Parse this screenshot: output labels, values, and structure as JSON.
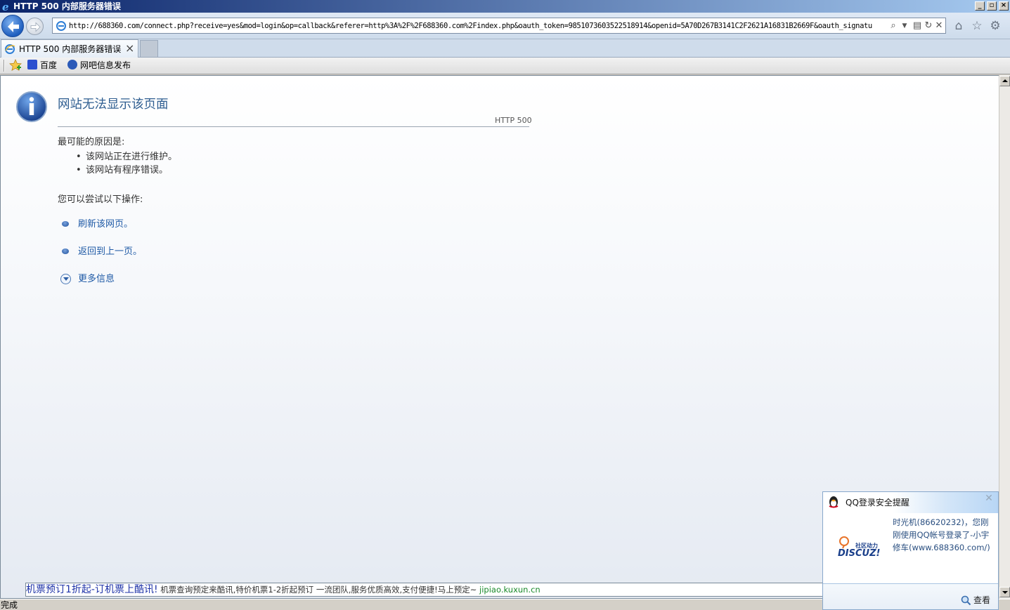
{
  "window": {
    "title": "HTTP 500 内部服务器错误",
    "minimize": "_",
    "restore": "▫",
    "close": "×"
  },
  "address_bar": {
    "url": "http://688360.com/connect.php?receive=yes&mod=login&op=callback&referer=http%3A%2F%2F688360.com%2Findex.php&oauth_token=9851073603522518914&openid=5A70D267B3141C2F2621A16831B2669F&oauth_signatu",
    "icons": [
      "search-icon",
      "dropdown-icon",
      "compat-view-icon",
      "refresh-icon",
      "stop-icon"
    ]
  },
  "toolbar_icons": [
    "home-icon",
    "favorites-star-icon",
    "tools-gear-icon"
  ],
  "tabs": [
    {
      "label": "HTTP  500  内部服务器错误",
      "close": "×"
    }
  ],
  "favorites": [
    {
      "label": "百度"
    },
    {
      "label": "网吧信息发布"
    }
  ],
  "error_page": {
    "title": "网站无法显示该页面",
    "code": "HTTP 500",
    "reasons_heading": "最可能的原因是:",
    "reasons": [
      "该网站正在进行维护。",
      "该网站有程序错误。"
    ],
    "actions_heading": "您可以尝试以下操作:",
    "actions": [
      "刷新该网页。",
      "返回到上一页。"
    ],
    "more_info": "更多信息"
  },
  "ad": {
    "title": "机票预订1折起-订机票上酷讯!",
    "description": " 机票查询预定来酷讯,特价机票1-2折起预订  一流团队,服务优质高效,支付便捷!马上预定~ ",
    "url": "jipiao.kuxun.cn"
  },
  "status_bar": {
    "text": "完成"
  },
  "qq_popup": {
    "title": "QQ登录安全提醒",
    "message": "时光机(86620232)，您刚刚使用QQ帐号登录了-小宇修车(www.688360.com/)",
    "logo_text_small": "社区动力",
    "logo_text_big": "DISCUZ!",
    "view_label": "查看"
  },
  "colors": {
    "title_bar_start": "#0a246a",
    "link_blue": "#1f5aa6",
    "error_title": "#2e5d90",
    "ad_url_green": "#1a8a2a"
  }
}
